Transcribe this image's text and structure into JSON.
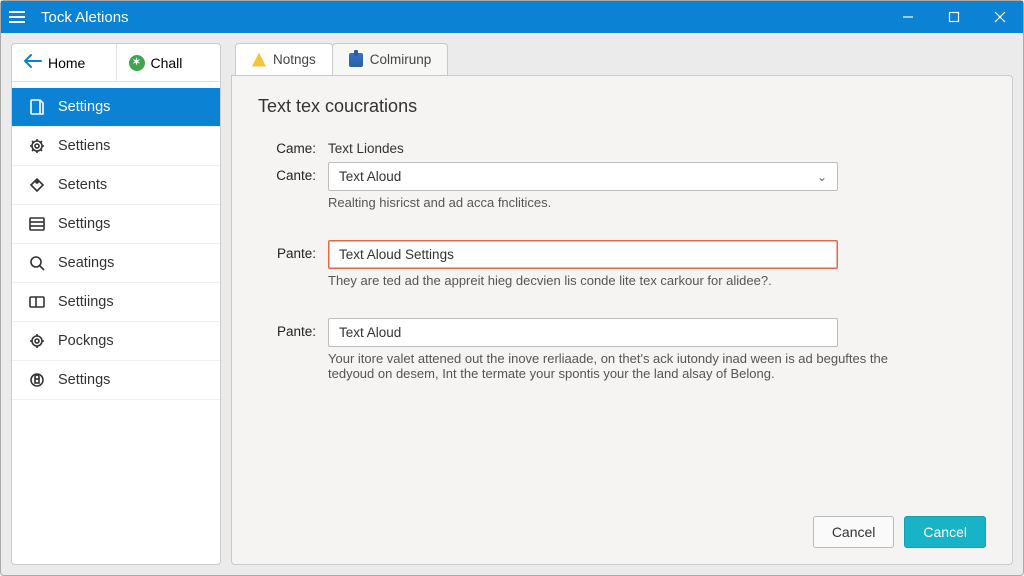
{
  "titlebar": {
    "title": "Tock Aletions"
  },
  "sidebar": {
    "top": {
      "home": "Home",
      "chall": "Chall"
    },
    "items": [
      {
        "label": "Settings"
      },
      {
        "label": "Settiens"
      },
      {
        "label": "Setents"
      },
      {
        "label": "Settings"
      },
      {
        "label": "Seatings"
      },
      {
        "label": "Settiings"
      },
      {
        "label": "Pockngs"
      },
      {
        "label": "Settings"
      }
    ]
  },
  "tabs": [
    {
      "label": "Notngs"
    },
    {
      "label": "Colmirunp"
    }
  ],
  "panel": {
    "heading": "Text tex coucrations",
    "rows": {
      "came": {
        "label": "Came:",
        "value": "Text Liondes"
      },
      "cante": {
        "label": "Cante:",
        "value": "Text Aloud",
        "help": "Realting hisricst and ad acca fnclitices."
      },
      "pante1": {
        "label": "Pante:",
        "value": "Text Aloud Settings",
        "help": "They are ted ad the appreit hieg decvien lis conde lite tex carkour for alidee?."
      },
      "pante2": {
        "label": "Pante:",
        "value": "Text Aloud",
        "help": "Your itore valet attened out the inove rerliaade, on thet's ack iutondy inad ween is ad beguftes the tedyoud on desem, Int the termate your spontis your the land alsay of Belong."
      }
    }
  },
  "footer": {
    "cancel": "Cancel",
    "ok": "Cancel"
  }
}
